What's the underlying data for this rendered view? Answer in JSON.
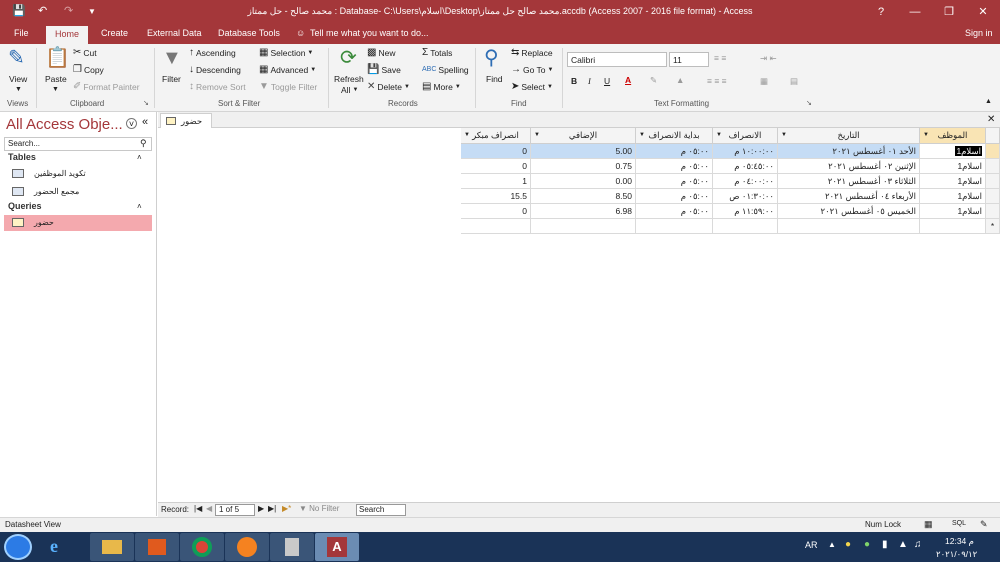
{
  "titlebar": {
    "title": "محمد صالح - حل ممتاز : Database- C:\\Users\\اسلام\\Desktop\\محمد صالح حل ممتاز.accdb (Access 2007 - 2016 file format) - Access",
    "help": "?"
  },
  "tabs": [
    "File",
    "Home",
    "Create",
    "External Data",
    "Database Tools"
  ],
  "tell_me": "Tell me what you want to do...",
  "sign_in": "Sign in",
  "ribbon": {
    "views": {
      "view": "View",
      "label": "Views"
    },
    "clipboard": {
      "paste": "Paste",
      "cut": "Cut",
      "copy": "Copy",
      "format_painter": "Format Painter",
      "label": "Clipboard"
    },
    "sort_filter": {
      "filter": "Filter",
      "ascending": "Ascending",
      "descending": "Descending",
      "remove_sort": "Remove Sort",
      "selection": "Selection",
      "advanced": "Advanced",
      "toggle_filter": "Toggle Filter",
      "label": "Sort & Filter"
    },
    "records": {
      "refresh": "Refresh",
      "refresh_all": "All",
      "new": "New",
      "save": "Save",
      "delete": "Delete",
      "totals": "Totals",
      "spelling": "Spelling",
      "more": "More",
      "label": "Records"
    },
    "find": {
      "find": "Find",
      "replace": "Replace",
      "goto": "Go To",
      "select": "Select",
      "label": "Find"
    },
    "text_formatting": {
      "font": "Calibri",
      "size": "11",
      "bold": "B",
      "italic": "I",
      "underline": "U",
      "label": "Text Formatting"
    }
  },
  "nav": {
    "title": "All Access Obje...",
    "search_placeholder": "Search...",
    "sections": [
      {
        "name": "Tables",
        "items": [
          "تكويد الموظفين",
          "مجمع الحضور"
        ]
      },
      {
        "name": "Queries",
        "items": [
          "حضور"
        ]
      }
    ]
  },
  "document_tab": "حضور",
  "grid": {
    "columns": [
      "الموظف",
      "التاريخ",
      "الانصراف",
      "بداية الانصراف",
      "الإضافي",
      "انصراف مبكر"
    ],
    "rows": [
      [
        "اسلام1",
        "الأحد ٠١ أغسطس ٢٠٢١",
        "١٠:٠٠:٠٠ م",
        "٠٥:٠٠ م",
        "5.00",
        "0"
      ],
      [
        "اسلام1",
        "الإثنين ٠٢ أغسطس ٢٠٢١",
        "٠٥:٤٥:٠٠ م",
        "٠٥:٠٠ م",
        "0.75",
        "0"
      ],
      [
        "اسلام1",
        "الثلاثاء ٠٣ أغسطس ٢٠٢١",
        "٠٤:٠٠:٠٠ م",
        "٠٥:٠٠ م",
        "0.00",
        "1"
      ],
      [
        "اسلام1",
        "الأربعاء ٠٤ أغسطس ٢٠٢١",
        "٠١:٣٠:٠٠ ص",
        "٠٥:٠٠ م",
        "8.50",
        "15.5"
      ],
      [
        "اسلام1",
        "الخميس ٠٥ أغسطس ٢٠٢١",
        "١١:٥٩:٠٠ م",
        "٠٥:٠٠ م",
        "6.98",
        "0"
      ]
    ],
    "new_row_marker": "*"
  },
  "record_nav": {
    "label": "Record:",
    "current": "1 of 5",
    "no_filter": "No Filter",
    "search": "Search"
  },
  "status": {
    "view": "Datasheet View",
    "num_lock": "Num Lock",
    "sql": "SQL"
  },
  "taskbar": {
    "lang": "AR",
    "time": "12:34 م",
    "date": "٢٠٢١/٠٩/١٢"
  },
  "colors": {
    "accent": "#a4373a",
    "selected_row": "#c5dcf5",
    "nav_selected": "#f4a9ae"
  }
}
